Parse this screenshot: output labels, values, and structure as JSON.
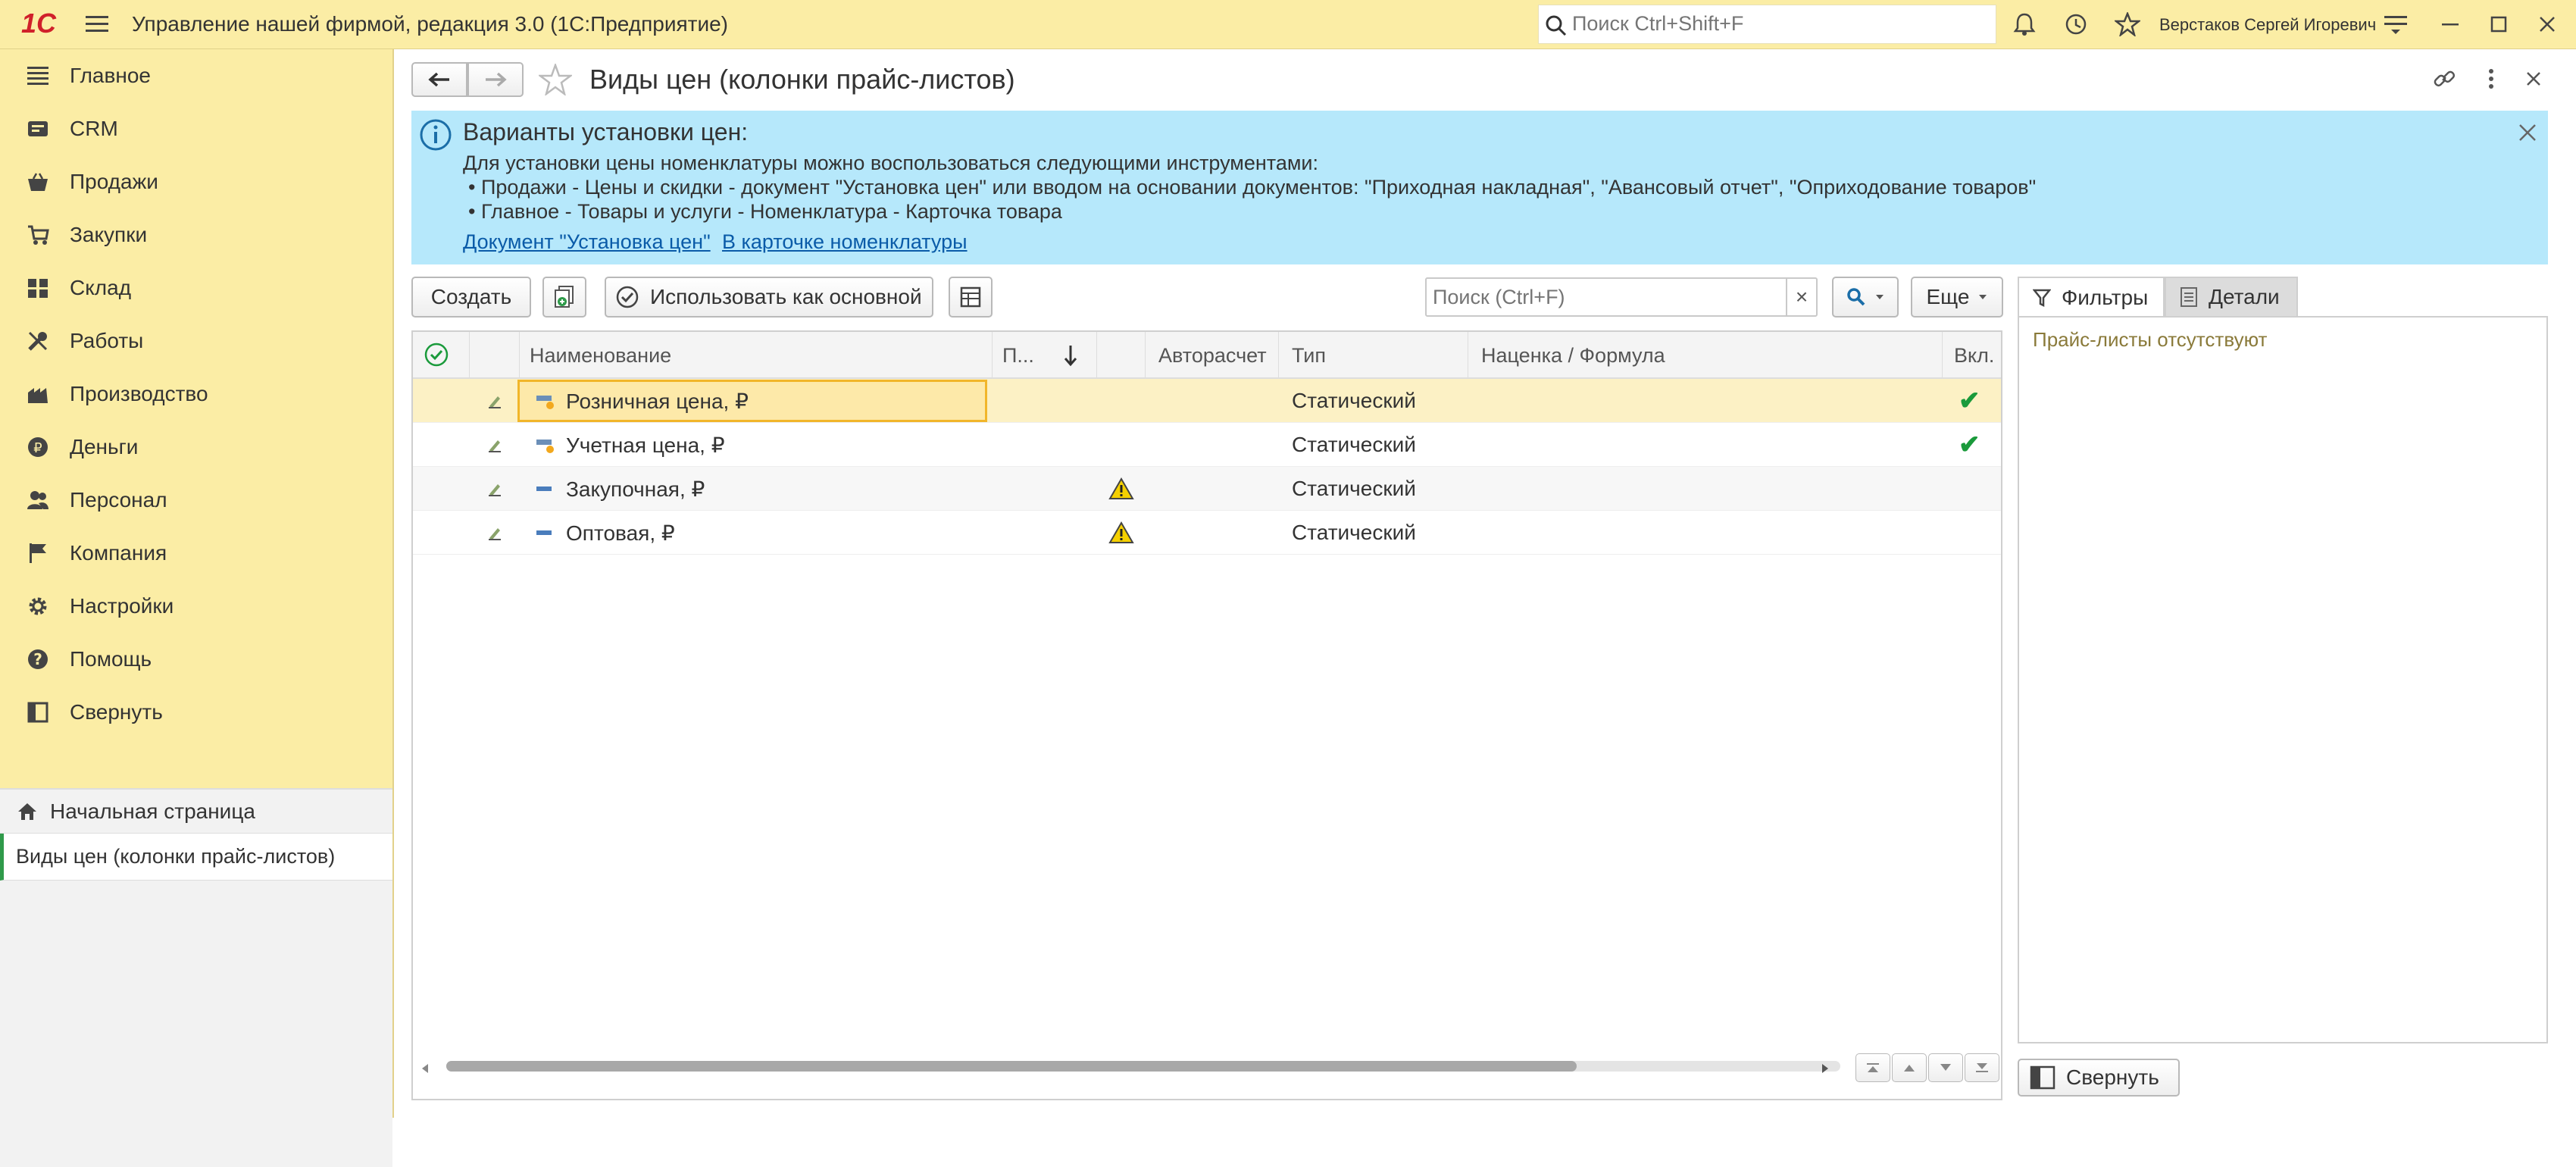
{
  "app": {
    "logo": "1С",
    "title": "Управление нашей фирмой, редакция 3.0  (1С:Предприятие)",
    "search_placeholder": "Поиск Ctrl+Shift+F",
    "user": "Верстаков Сергей Игоревич"
  },
  "sidebar": {
    "items": [
      {
        "label": "Главное",
        "icon": "list-icon"
      },
      {
        "label": "CRM",
        "icon": "crm-icon"
      },
      {
        "label": "Продажи",
        "icon": "basket-icon"
      },
      {
        "label": "Закупки",
        "icon": "purchase-icon"
      },
      {
        "label": "Склад",
        "icon": "warehouse-icon"
      },
      {
        "label": "Работы",
        "icon": "tools-icon"
      },
      {
        "label": "Производство",
        "icon": "factory-icon"
      },
      {
        "label": "Деньги",
        "icon": "ruble-icon"
      },
      {
        "label": "Персонал",
        "icon": "people-icon"
      },
      {
        "label": "Компания",
        "icon": "flag-icon"
      },
      {
        "label": "Настройки",
        "icon": "gear-icon"
      },
      {
        "label": "Помощь",
        "icon": "help-icon"
      },
      {
        "label": "Свернуть",
        "icon": "collapse-icon"
      }
    ],
    "open_pages": [
      {
        "label": "Начальная страница"
      },
      {
        "label": "Виды цен (колонки прайс-листов)"
      }
    ]
  },
  "form": {
    "title": "Виды цен (колонки прайс-листов)",
    "info": {
      "heading": "Варианты установки цен:",
      "line1": "Для установки цены номенклатуры можно воспользоваться следующими инструментами:",
      "line2": "• Продажи - Цены и скидки - документ \"Установка цен\" или вводом на основании документов: \"Приходная накладная\", \"Авансовый отчет\", \"Оприходование товаров\"",
      "line3": "• Главное - Товары и услуги - Номенклатура - Карточка товара",
      "link1": "Документ \"Установка цен\"",
      "link2": "В карточке номенклатуры"
    },
    "toolbar": {
      "create": "Создать",
      "use_main": "Использовать как основной",
      "search_placeholder": "Поиск (Ctrl+F)",
      "clear": "×",
      "more": "Еще"
    },
    "columns": {
      "name": "Наименование",
      "p": "П...",
      "auto": "Авторасчет",
      "type": "Тип",
      "markup": "Наценка / Формула",
      "enabled": "Вкл."
    },
    "rows": [
      {
        "name": "Розничная цена, ₽",
        "type": "Статический",
        "enabled": "✔",
        "warning": ""
      },
      {
        "name": "Учетная цена, ₽",
        "type": "Статический",
        "enabled": "✔",
        "warning": ""
      },
      {
        "name": "Закупочная, ₽",
        "type": "Статический",
        "enabled": "",
        "warning": "!"
      },
      {
        "name": "Оптовая, ₽",
        "type": "Статический",
        "enabled": "",
        "warning": "!"
      }
    ],
    "side": {
      "tab_filters": "Фильтры",
      "tab_details": "Детали",
      "empty_text": "Прайс-листы отсутствуют",
      "collapse": "Свернуть"
    }
  },
  "colors": {
    "accent": "#fbeda5",
    "info_bg": "#b6e8fb",
    "selected_row": "#fcf1c5",
    "check": "#1a9a3b",
    "link": "#0a5ba8"
  }
}
